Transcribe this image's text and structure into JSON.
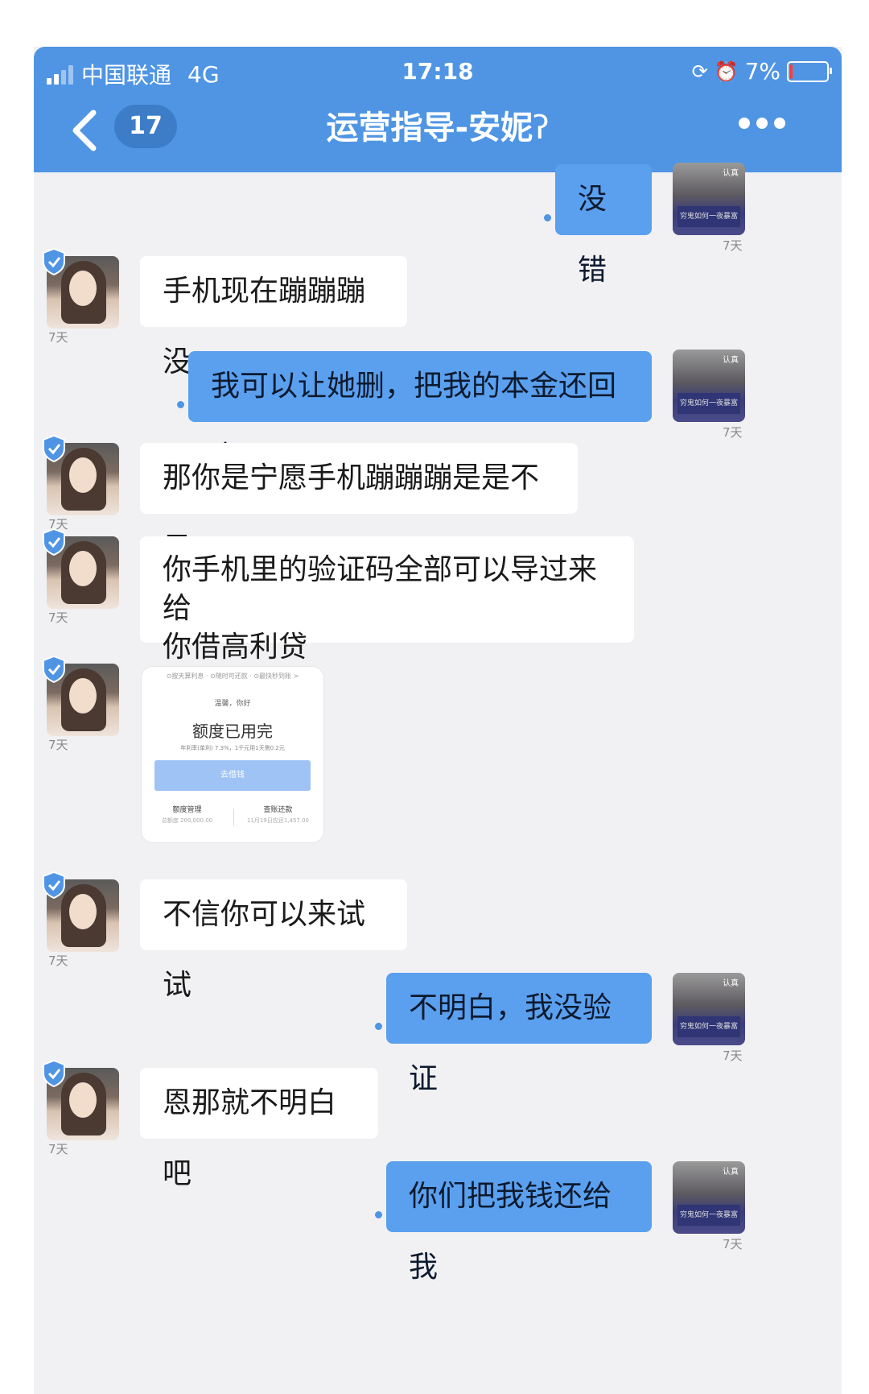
{
  "status": {
    "carrier": "中国联通",
    "network": "4G",
    "time": "17:18",
    "battery": "7%",
    "battery_level": 0.07
  },
  "header": {
    "unread_count": "17",
    "title": "运营指导-安妮"
  },
  "messages": [
    {
      "side": "out",
      "text": "没错",
      "time": "7天"
    },
    {
      "side": "in",
      "text": "手机现在蹦蹦蹦没",
      "time": "7天"
    },
    {
      "side": "out",
      "text": "我可以让她删，把我的本金还回来",
      "time": "7天"
    },
    {
      "side": "in",
      "text": "那你是宁愿手机蹦蹦蹦是是不是",
      "time": "7天"
    },
    {
      "side": "in",
      "text": "你手机里的验证码全部可以导过来给你借高利贷",
      "line1": "你手机里的验证码全部可以导过来给",
      "line2": "你借高利贷",
      "time": "7天"
    },
    {
      "side": "in",
      "type": "image",
      "time": "7天"
    },
    {
      "side": "in",
      "text": "不信你可以来试试",
      "time": "7天"
    },
    {
      "side": "out",
      "text": "不明白，我没验证",
      "time": "7天"
    },
    {
      "side": "in",
      "text": "恩那就不明白吧",
      "time": "7天"
    },
    {
      "side": "out",
      "text": "你们把我钱还给我",
      "time": "7天"
    }
  ],
  "card": {
    "tabs": "⊙按天算利息 · ⊙随时可还款 · ⊙最快秒到账 >",
    "greeting": "温馨，你好",
    "heading": "额度已用完",
    "rate": "年利率(单利) 7.3%，1千元用1天需0.2元",
    "button": "去借钱",
    "left_label": "额度管理",
    "left_value": "总额度 200,000.00",
    "right_label": "查账还款",
    "right_value": "11月19日应还1,457.00"
  },
  "avatar_text": {
    "book": "穷鬼如何一夜暴富",
    "tag": "认真"
  }
}
